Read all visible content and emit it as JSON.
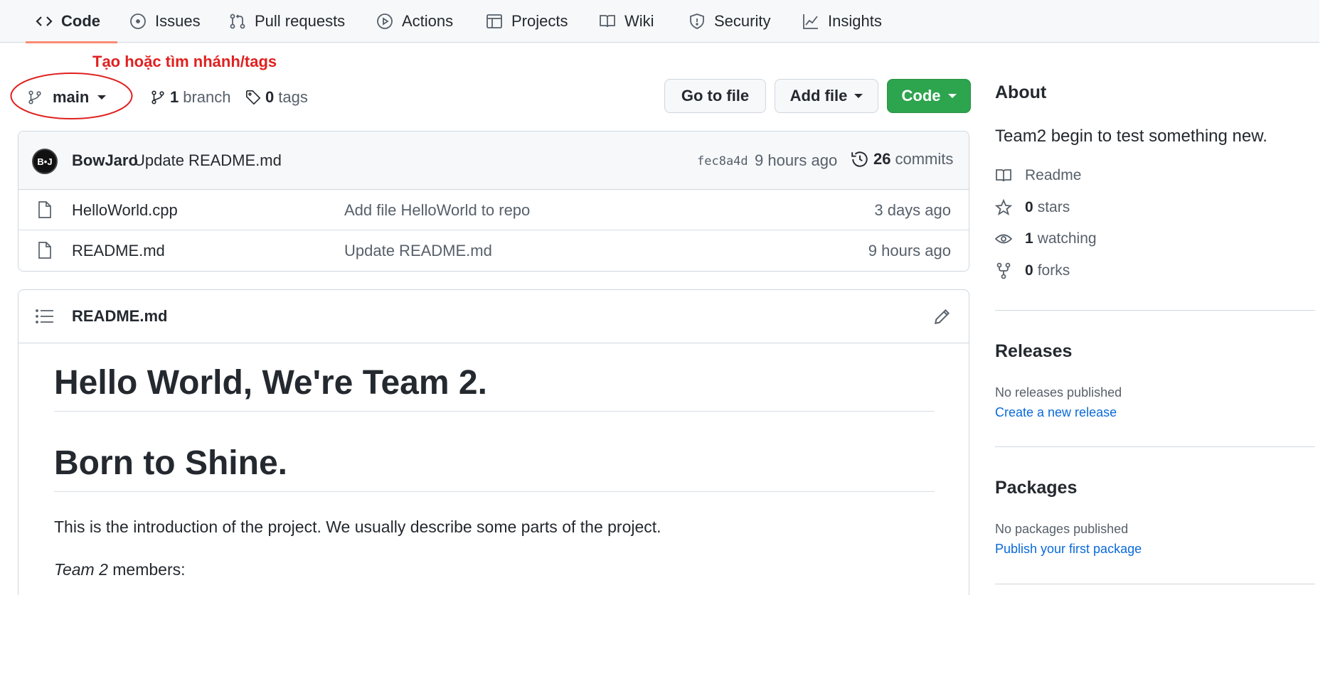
{
  "nav": {
    "tabs": [
      {
        "label": "Code",
        "icon": "code-icon",
        "selected": true
      },
      {
        "label": "Issues",
        "icon": "issue-icon"
      },
      {
        "label": "Pull requests",
        "icon": "pull-request-icon"
      },
      {
        "label": "Actions",
        "icon": "play-icon"
      },
      {
        "label": "Projects",
        "icon": "table-icon"
      },
      {
        "label": "Wiki",
        "icon": "book-icon"
      },
      {
        "label": "Security",
        "icon": "shield-icon"
      },
      {
        "label": "Insights",
        "icon": "graph-icon"
      }
    ]
  },
  "annotation": {
    "text": "Tạo hoặc tìm nhánh/tags",
    "color": "#e02020"
  },
  "filenav": {
    "branch": "main",
    "branch_count": "1",
    "branch_label": "branch",
    "tag_count": "0",
    "tag_label": "tags",
    "go_to_file": "Go to file",
    "add_file": "Add file",
    "code_button": "Code"
  },
  "commit": {
    "avatar_text": "B•J",
    "author": "BowJaro",
    "message": "Update README.md",
    "sha": "fec8a4d",
    "time": "9 hours ago",
    "count": "26",
    "count_label": "commits"
  },
  "files": [
    {
      "name": "HelloWorld.cpp",
      "message": "Add file HelloWorld to repo",
      "age": "3 days ago"
    },
    {
      "name": "README.md",
      "message": "Update README.md",
      "age": "9 hours ago"
    }
  ],
  "readme": {
    "title": "README.md",
    "h1_first": "Hello World, We're Team 2.",
    "h1_second": "Born to Shine.",
    "intro": "This is the introduction of the project. We usually describe some parts of the project.",
    "members_em": "Team 2",
    "members_rest": " members:"
  },
  "sidebar": {
    "about_title": "About",
    "description": "Team2 begin to test something new.",
    "readme_label": "Readme",
    "stars_count": "0",
    "stars_label": "stars",
    "watching_count": "1",
    "watching_label": "watching",
    "forks_count": "0",
    "forks_label": "forks",
    "releases_title": "Releases",
    "releases_none": "No releases published",
    "releases_link": "Create a new release",
    "packages_title": "Packages",
    "packages_none": "No packages published",
    "packages_link": "Publish your first package"
  },
  "colors": {
    "accent_green": "#2da44e",
    "tab_underline": "#fd8c73",
    "link_blue": "#0969da"
  }
}
